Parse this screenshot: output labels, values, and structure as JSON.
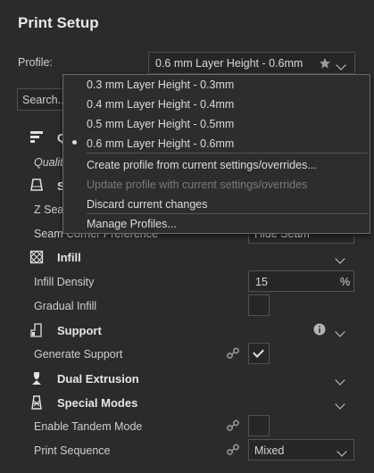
{
  "panel": {
    "title": "Print Setup"
  },
  "profile": {
    "label": "Profile:",
    "value": "0.6 mm Layer Height - 0.6mm"
  },
  "search": {
    "placeholder": "Search..."
  },
  "quality": {
    "label": "Q",
    "sub": "Qualit"
  },
  "shell": {
    "label": "S",
    "zseam": "Z Sea",
    "seam_corner": "Seam Corner Preference",
    "seam_value": "Hide Seam"
  },
  "infill": {
    "label": "Infill",
    "density_label": "Infill Density",
    "density_value": "15",
    "density_unit": "%",
    "gradual_label": "Gradual Infill"
  },
  "support": {
    "label": "Support",
    "generate_label": "Generate Support"
  },
  "dual": {
    "label": "Dual Extrusion"
  },
  "special": {
    "label": "Special Modes",
    "tandem_label": "Enable Tandem Mode",
    "sequence_label": "Print Sequence",
    "sequence_value": "Mixed"
  },
  "menu": {
    "profiles": [
      "0.3 mm Layer Height - 0.3mm",
      "0.4 mm Layer Height - 0.4mm",
      "0.5 mm Layer Height - 0.5mm",
      "0.6 mm Layer Height - 0.6mm"
    ],
    "create": "Create profile from current settings/overrides...",
    "update": "Update profile with current settings/overrides",
    "discard": "Discard current changes",
    "manage": "Manage Profiles..."
  },
  "colors": {
    "background": "#2b2b2b",
    "text": "#d6d6d6",
    "disabled": "#7b7b7b"
  }
}
